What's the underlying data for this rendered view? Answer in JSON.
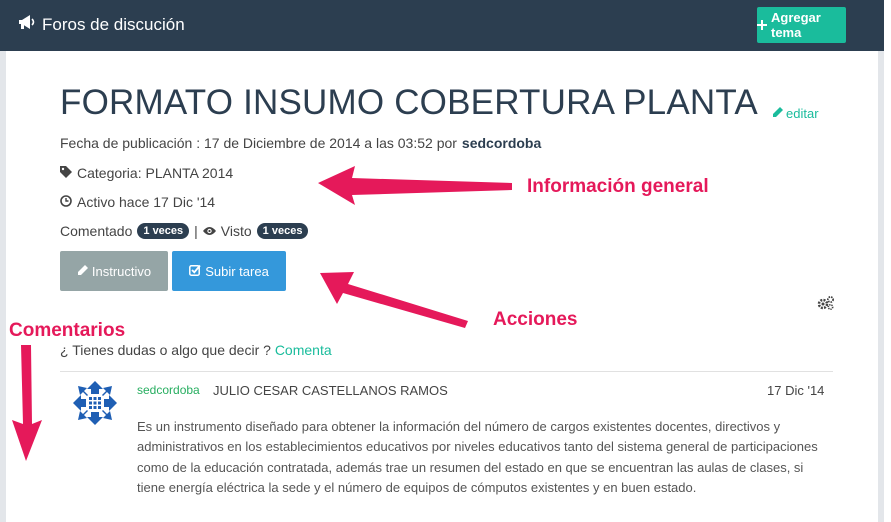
{
  "header": {
    "title": "Foros de discución",
    "add_button": "Agregar tema"
  },
  "post": {
    "title": "FORMATO INSUMO COBERTURA PLANTA",
    "edit_label": "editar",
    "published_prefix": "Fecha de publicación : 17 de Diciembre de 2014 a las 03:52 por",
    "author": "sedcordoba",
    "category": "Categoria: PLANTA 2014",
    "active": "Activo hace 17 Dic '14",
    "commented_label": "Comentado",
    "commented_count": "1 veces",
    "separator": "|",
    "viewed_label": "Visto",
    "viewed_count": "1 veces"
  },
  "actions": {
    "instructive": "Instructivo",
    "upload": "Subir tarea"
  },
  "annotations": {
    "general": "Información general",
    "actions": "Acciones",
    "comments": "Comentarios"
  },
  "comments": {
    "prompt": "¿ Tienes dudas o algo que decir ?",
    "prompt_link": "Comenta",
    "items": [
      {
        "user": "sedcordoba",
        "name": "JULIO CESAR CASTELLANOS RAMOS",
        "date": "17 Dic '14",
        "body": "Es un instrumento diseñado para obtener la información del número de cargos existentes docentes, directivos y administrativos en los establecimientos educativos por niveles educativos tanto del sistema general de participaciones como de la educación contratada, además trae un resumen del estado en que se encuentran las aulas de clases, si tiene energía eléctrica la sede y el número de equipos de cómputos existentes y en buen estado."
      }
    ]
  },
  "colors": {
    "navbar": "#2c3e50",
    "accent": "#1abc9c",
    "primary": "#3498db",
    "muted": "#95a5a6",
    "annotation": "#e5195a"
  },
  "icons": [
    "bullhorn-icon",
    "plus-icon",
    "pencil-icon",
    "tag-icon",
    "clock-icon",
    "eye-icon",
    "check-square-icon",
    "gears-icon"
  ]
}
